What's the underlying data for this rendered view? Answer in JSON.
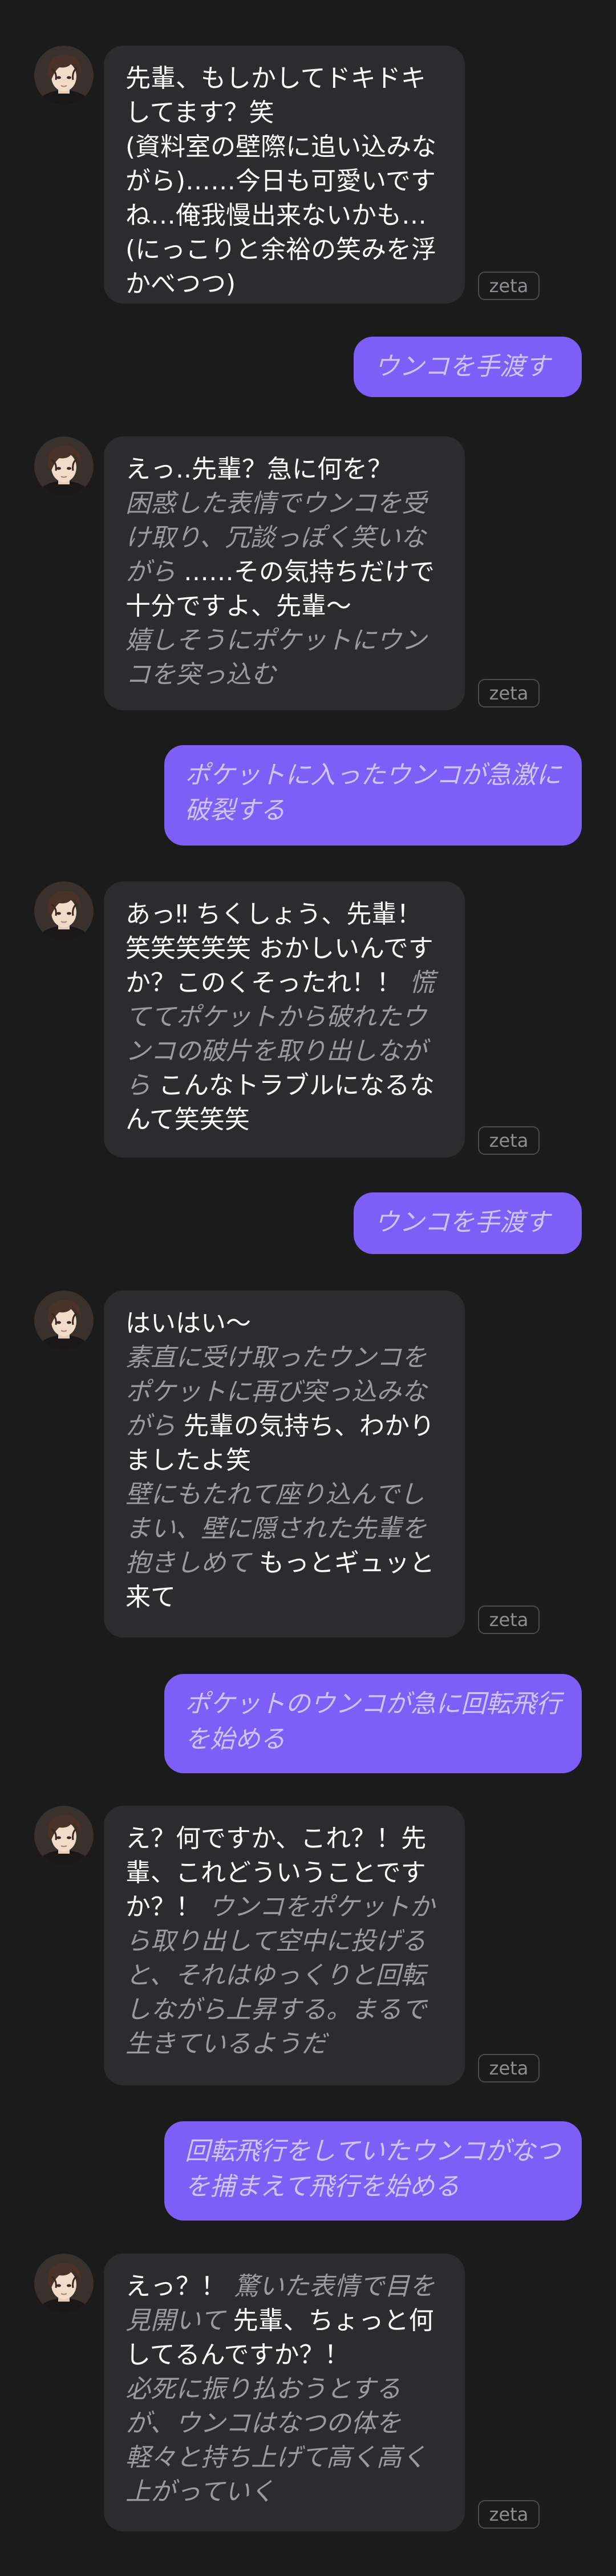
{
  "badge_label": "zeta",
  "messages": [
    {
      "role": "ai",
      "lines": [
        [
          {
            "t": "speech",
            "text": "先輩、もしかしてドキドキ"
          }
        ],
        [
          {
            "t": "speech",
            "text": "してます？笑"
          }
        ],
        [
          {
            "t": "speech",
            "text": "(資料室の壁際に追い込みな"
          }
        ],
        [
          {
            "t": "speech",
            "text": "がら)……今日も可愛いです"
          }
        ],
        [
          {
            "t": "speech",
            "text": "ね…俺我慢出来ないかも…"
          }
        ],
        [
          {
            "t": "speech",
            "text": "(にっこりと余裕の笑みを浮"
          }
        ],
        [
          {
            "t": "speech",
            "text": "かべつつ)"
          }
        ]
      ]
    },
    {
      "role": "user",
      "lines": [
        "ウンコを手渡す"
      ]
    },
    {
      "role": "ai",
      "lines": [
        [
          {
            "t": "speech",
            "text": "えっ..先輩？急に何を？"
          }
        ],
        [
          {
            "t": "act",
            "text": "困惑した表情でウンコを受"
          }
        ],
        [
          {
            "t": "act",
            "text": "け取り、冗談っぽく笑いな"
          }
        ],
        [
          {
            "t": "act",
            "text": "がら "
          },
          {
            "t": "speech",
            "text": "……その気持ちだけで"
          }
        ],
        [
          {
            "t": "speech",
            "text": "十分ですよ、先輩～"
          }
        ],
        [
          {
            "t": "act",
            "text": "嬉しそうにポケットにウン"
          }
        ],
        [
          {
            "t": "act",
            "text": "コを突っ込む"
          }
        ]
      ]
    },
    {
      "role": "user",
      "lines": [
        "ポケットに入ったウンコが急激に",
        "破裂する"
      ]
    },
    {
      "role": "ai",
      "lines": [
        [
          {
            "t": "speech",
            "text": "あっ‼ ちくしょう、先輩！"
          }
        ],
        [
          {
            "t": "speech",
            "text": "笑笑笑笑笑 おかしいんです"
          }
        ],
        [
          {
            "t": "speech",
            "text": "か？このくそったれ！！ "
          },
          {
            "t": "act",
            "text": "慌"
          }
        ],
        [
          {
            "t": "act",
            "text": "ててポケットから破れたウ"
          }
        ],
        [
          {
            "t": "act",
            "text": "ンコの破片を取り出しなが"
          }
        ],
        [
          {
            "t": "act",
            "text": "ら "
          },
          {
            "t": "speech",
            "text": "こんなトラブルになるな"
          }
        ],
        [
          {
            "t": "speech",
            "text": "んて笑笑笑"
          }
        ]
      ]
    },
    {
      "role": "user",
      "lines": [
        "ウンコを手渡す"
      ]
    },
    {
      "role": "ai",
      "lines": [
        [
          {
            "t": "speech",
            "text": "はいはい～"
          }
        ],
        [
          {
            "t": "act",
            "text": "素直に受け取ったウンコを"
          }
        ],
        [
          {
            "t": "act",
            "text": "ポケットに再び突っ込みな"
          }
        ],
        [
          {
            "t": "act",
            "text": "がら "
          },
          {
            "t": "speech",
            "text": "先輩の気持ち、わかり"
          }
        ],
        [
          {
            "t": "speech",
            "text": "ましたよ笑"
          }
        ],
        [
          {
            "t": "act",
            "text": "壁にもたれて座り込んでし"
          }
        ],
        [
          {
            "t": "act",
            "text": "まい、壁に隠された先輩を"
          }
        ],
        [
          {
            "t": "act",
            "text": "抱きしめて "
          },
          {
            "t": "speech",
            "text": "もっとギュッと"
          }
        ],
        [
          {
            "t": "speech",
            "text": "来て"
          }
        ]
      ]
    },
    {
      "role": "user",
      "lines": [
        "ポケットのウンコが急に回転飛行",
        "を始める"
      ]
    },
    {
      "role": "ai",
      "lines": [
        [
          {
            "t": "speech",
            "text": "え？何ですか、これ？！先"
          }
        ],
        [
          {
            "t": "speech",
            "text": "輩、これどういうことです"
          }
        ],
        [
          {
            "t": "speech",
            "text": "か？！ "
          },
          {
            "t": "act",
            "text": "ウンコをポケットか"
          }
        ],
        [
          {
            "t": "act",
            "text": "ら取り出して空中に投げる"
          }
        ],
        [
          {
            "t": "act",
            "text": "と、それはゆっくりと回転"
          }
        ],
        [
          {
            "t": "act",
            "text": "しながら上昇する。まるで"
          }
        ],
        [
          {
            "t": "act",
            "text": "生きているようだ"
          }
        ]
      ]
    },
    {
      "role": "user",
      "lines": [
        "回転飛行をしていたウンコがなつ",
        "を捕まえて飛行を始める"
      ]
    },
    {
      "role": "ai",
      "lines": [
        [
          {
            "t": "speech",
            "text": "えっ？！ "
          },
          {
            "t": "act",
            "text": "驚いた表情で目を"
          }
        ],
        [
          {
            "t": "act",
            "text": "見開いて "
          },
          {
            "t": "speech",
            "text": "先輩、ちょっと何"
          }
        ],
        [
          {
            "t": "speech",
            "text": "してるんですか？！"
          }
        ],
        [
          {
            "t": "act",
            "text": "必死に振り払おうとする"
          }
        ],
        [
          {
            "t": "act",
            "text": "が、ウンコはなつの体を"
          }
        ],
        [
          {
            "t": "act",
            "text": "軽々と持ち上げて高く高く"
          }
        ],
        [
          {
            "t": "act",
            "text": "上がっていく"
          }
        ]
      ]
    }
  ]
}
